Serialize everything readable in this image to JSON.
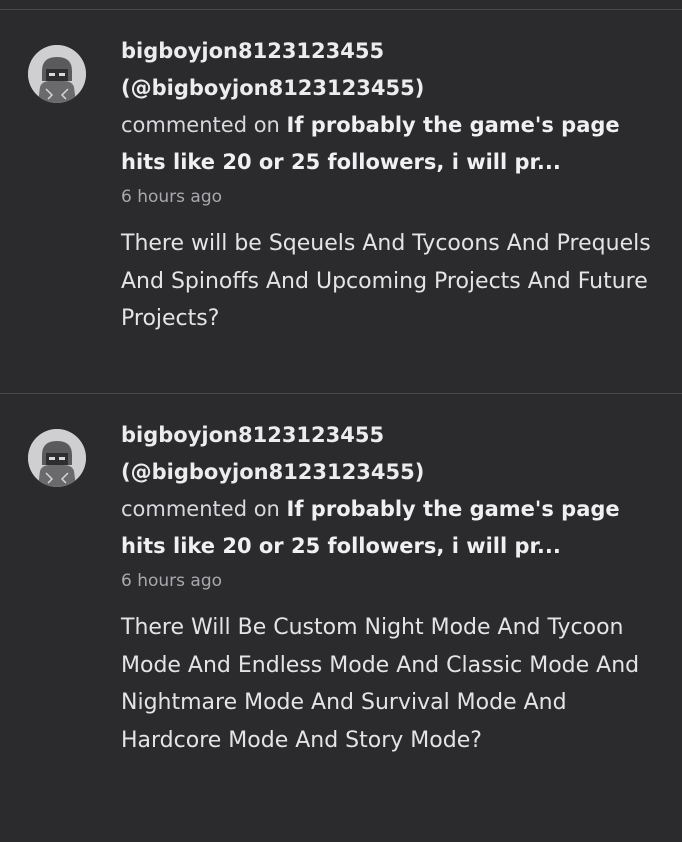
{
  "comments": [
    {
      "username": "bigboyjon8123123455",
      "handle": "(@bigboyjon8123123455)",
      "verb": "commented on",
      "target": "If probably the game's page hits like 20 or 25 followers, i will pr...",
      "time": "6 hours ago",
      "text": "There will be Sqeuels And Tycoons And Prequels And Spinoffs And Upcoming Projects And Future Projects?",
      "avatar_icon": "user-avatar-icon"
    },
    {
      "username": "bigboyjon8123123455",
      "handle": "(@bigboyjon8123123455)",
      "verb": "commented on",
      "target": "If probably the game's page hits like 20 or 25 followers, i will pr...",
      "time": "6 hours ago",
      "text": "There Will Be Custom Night Mode And Tycoon Mode And Endless Mode And Classic Mode And Nightmare Mode And Survival Mode And Hardcore Mode And Story Mode?",
      "avatar_icon": "user-avatar-icon"
    }
  ],
  "colors": {
    "background": "#2b2a2c",
    "divider": "#47464a",
    "muted_text": "#a9a8ad"
  }
}
